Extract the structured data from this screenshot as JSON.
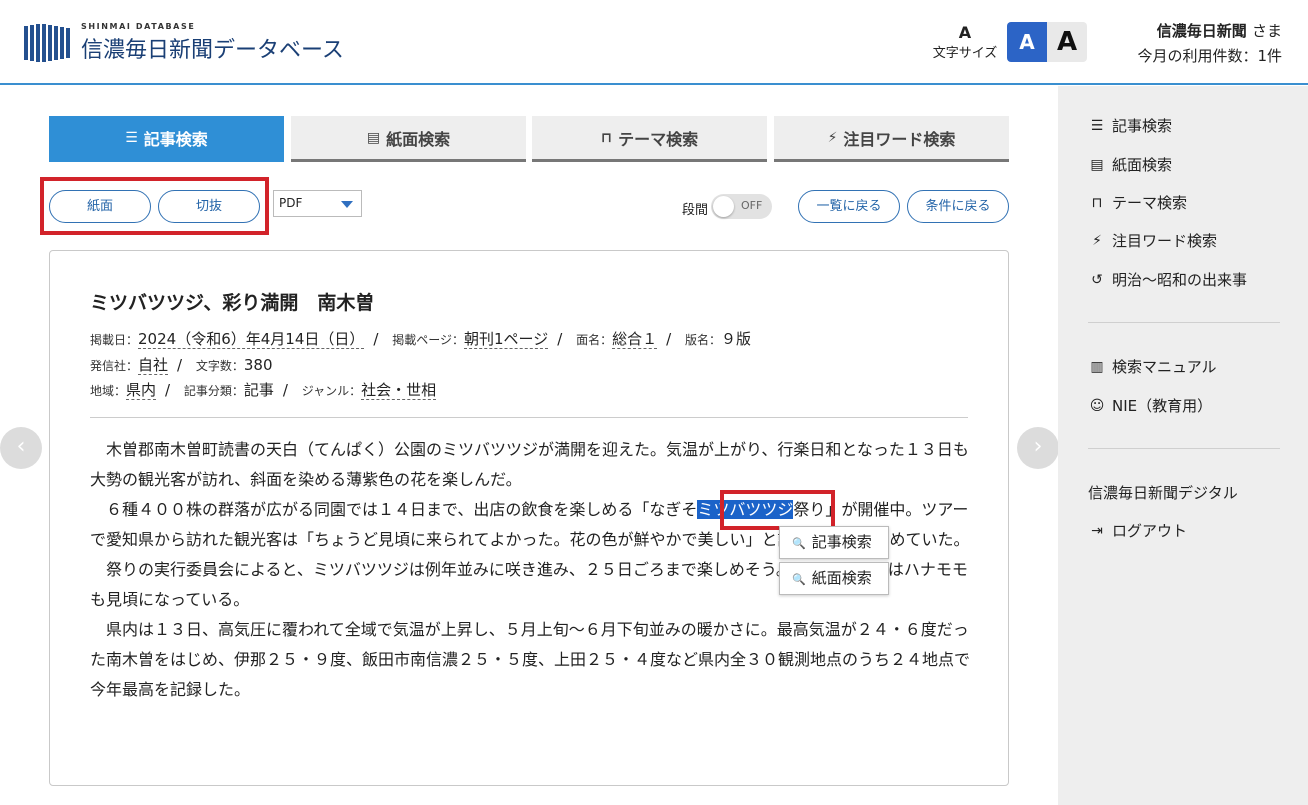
{
  "header": {
    "logo_sub": "SHINMAI DATABASE",
    "logo_main": "信濃毎日新聞データベース",
    "font_size_icon": "A",
    "font_size_label": "文字サイズ",
    "font_small": "A",
    "font_large": "A",
    "user_name": "信濃毎日新聞",
    "user_suffix": "さま",
    "usage": "今月の利用件数：1件"
  },
  "tabs": [
    {
      "icon": "list-icon",
      "label": "記事検索",
      "active": true
    },
    {
      "icon": "newspaper-icon",
      "label": "紙面検索",
      "active": false
    },
    {
      "icon": "bookmark-icon",
      "label": "テーマ検索",
      "active": false
    },
    {
      "icon": "bolt-icon",
      "label": "注目ワード検索",
      "active": false
    }
  ],
  "toolbar": {
    "shimen": "紙面",
    "kirinuki": "切抜",
    "format": "PDF",
    "danma_label": "段間",
    "toggle_state": "OFF",
    "back_list": "一覧に戻る",
    "back_cond": "条件に戻る"
  },
  "article": {
    "title": "ミツバツツジ、彩り満開　南木曽",
    "k_date": "掲載日：",
    "date": "2024（令和6）年4月14日（日）",
    "k_page": "掲載ページ：",
    "page": "朝刊1ページ",
    "k_men": "面名：",
    "men": "総合１",
    "k_han": "版名：",
    "han": "９版",
    "k_pub": "発信社：",
    "pub": "自社",
    "k_chars": "文字数：",
    "chars": "380",
    "k_region": "地域：",
    "region": "県内",
    "k_class": "記事分類：",
    "class": "記事",
    "k_genre": "ジャンル：",
    "genre": "社会・世相",
    "p1": "　木曽郡南木曽町読書の天白（てんぱく）公園のミツバツツジが満開を迎えた。気温が上がり、行楽日和となった１３日も大勢の観光客が訪れ、斜面を染める薄紫色の花を楽しんだ。",
    "p2_before": "　６種４００株の群落が広がる同園では１４日まで、出店の飲食を楽しめる「なぎそ",
    "p2_hl": "ミツバツツジ",
    "p2_after": "祭り」が開催中。ツアーで愛知県から訪れた観光客は「ちょうど見頃に来られてよかった。花の色が鮮やかで美しい」と話し、写真に収めていた。",
    "p3": "　祭りの実行委員会によると、ミツバツツジは例年並みに咲き進み、２５日ごろまで楽しめそう。公園入り口ではハナモモも見頃になっている。",
    "p4": "　県内は１３日、高気圧に覆われて全域で気温が上昇し、５月上旬〜６月下旬並みの暖かさに。最高気温が２４・６度だった南木曽をはじめ、伊那２５・９度、飯田市南信濃２５・５度、上田２５・４度など県内全３０観測地点のうち２４地点で今年最高を記録した。"
  },
  "popup": {
    "kiji": "記事検索",
    "shimen": "紙面検索"
  },
  "sidebar": {
    "items": [
      {
        "icon": "list-icon",
        "label": "記事検索"
      },
      {
        "icon": "newspaper-icon",
        "label": "紙面検索"
      },
      {
        "icon": "bookmark-icon",
        "label": "テーマ検索"
      },
      {
        "icon": "bolt-icon",
        "label": "注目ワード検索"
      },
      {
        "icon": "history-icon",
        "label": "明治〜昭和の出来事"
      },
      {
        "icon": "book-icon",
        "label": "検索マニュアル"
      },
      {
        "icon": "nie-icon",
        "label": "NIE（教育用）"
      },
      {
        "icon": "",
        "label": "信濃毎日新聞デジタル"
      },
      {
        "icon": "logout-icon",
        "label": "ログアウト"
      }
    ]
  }
}
